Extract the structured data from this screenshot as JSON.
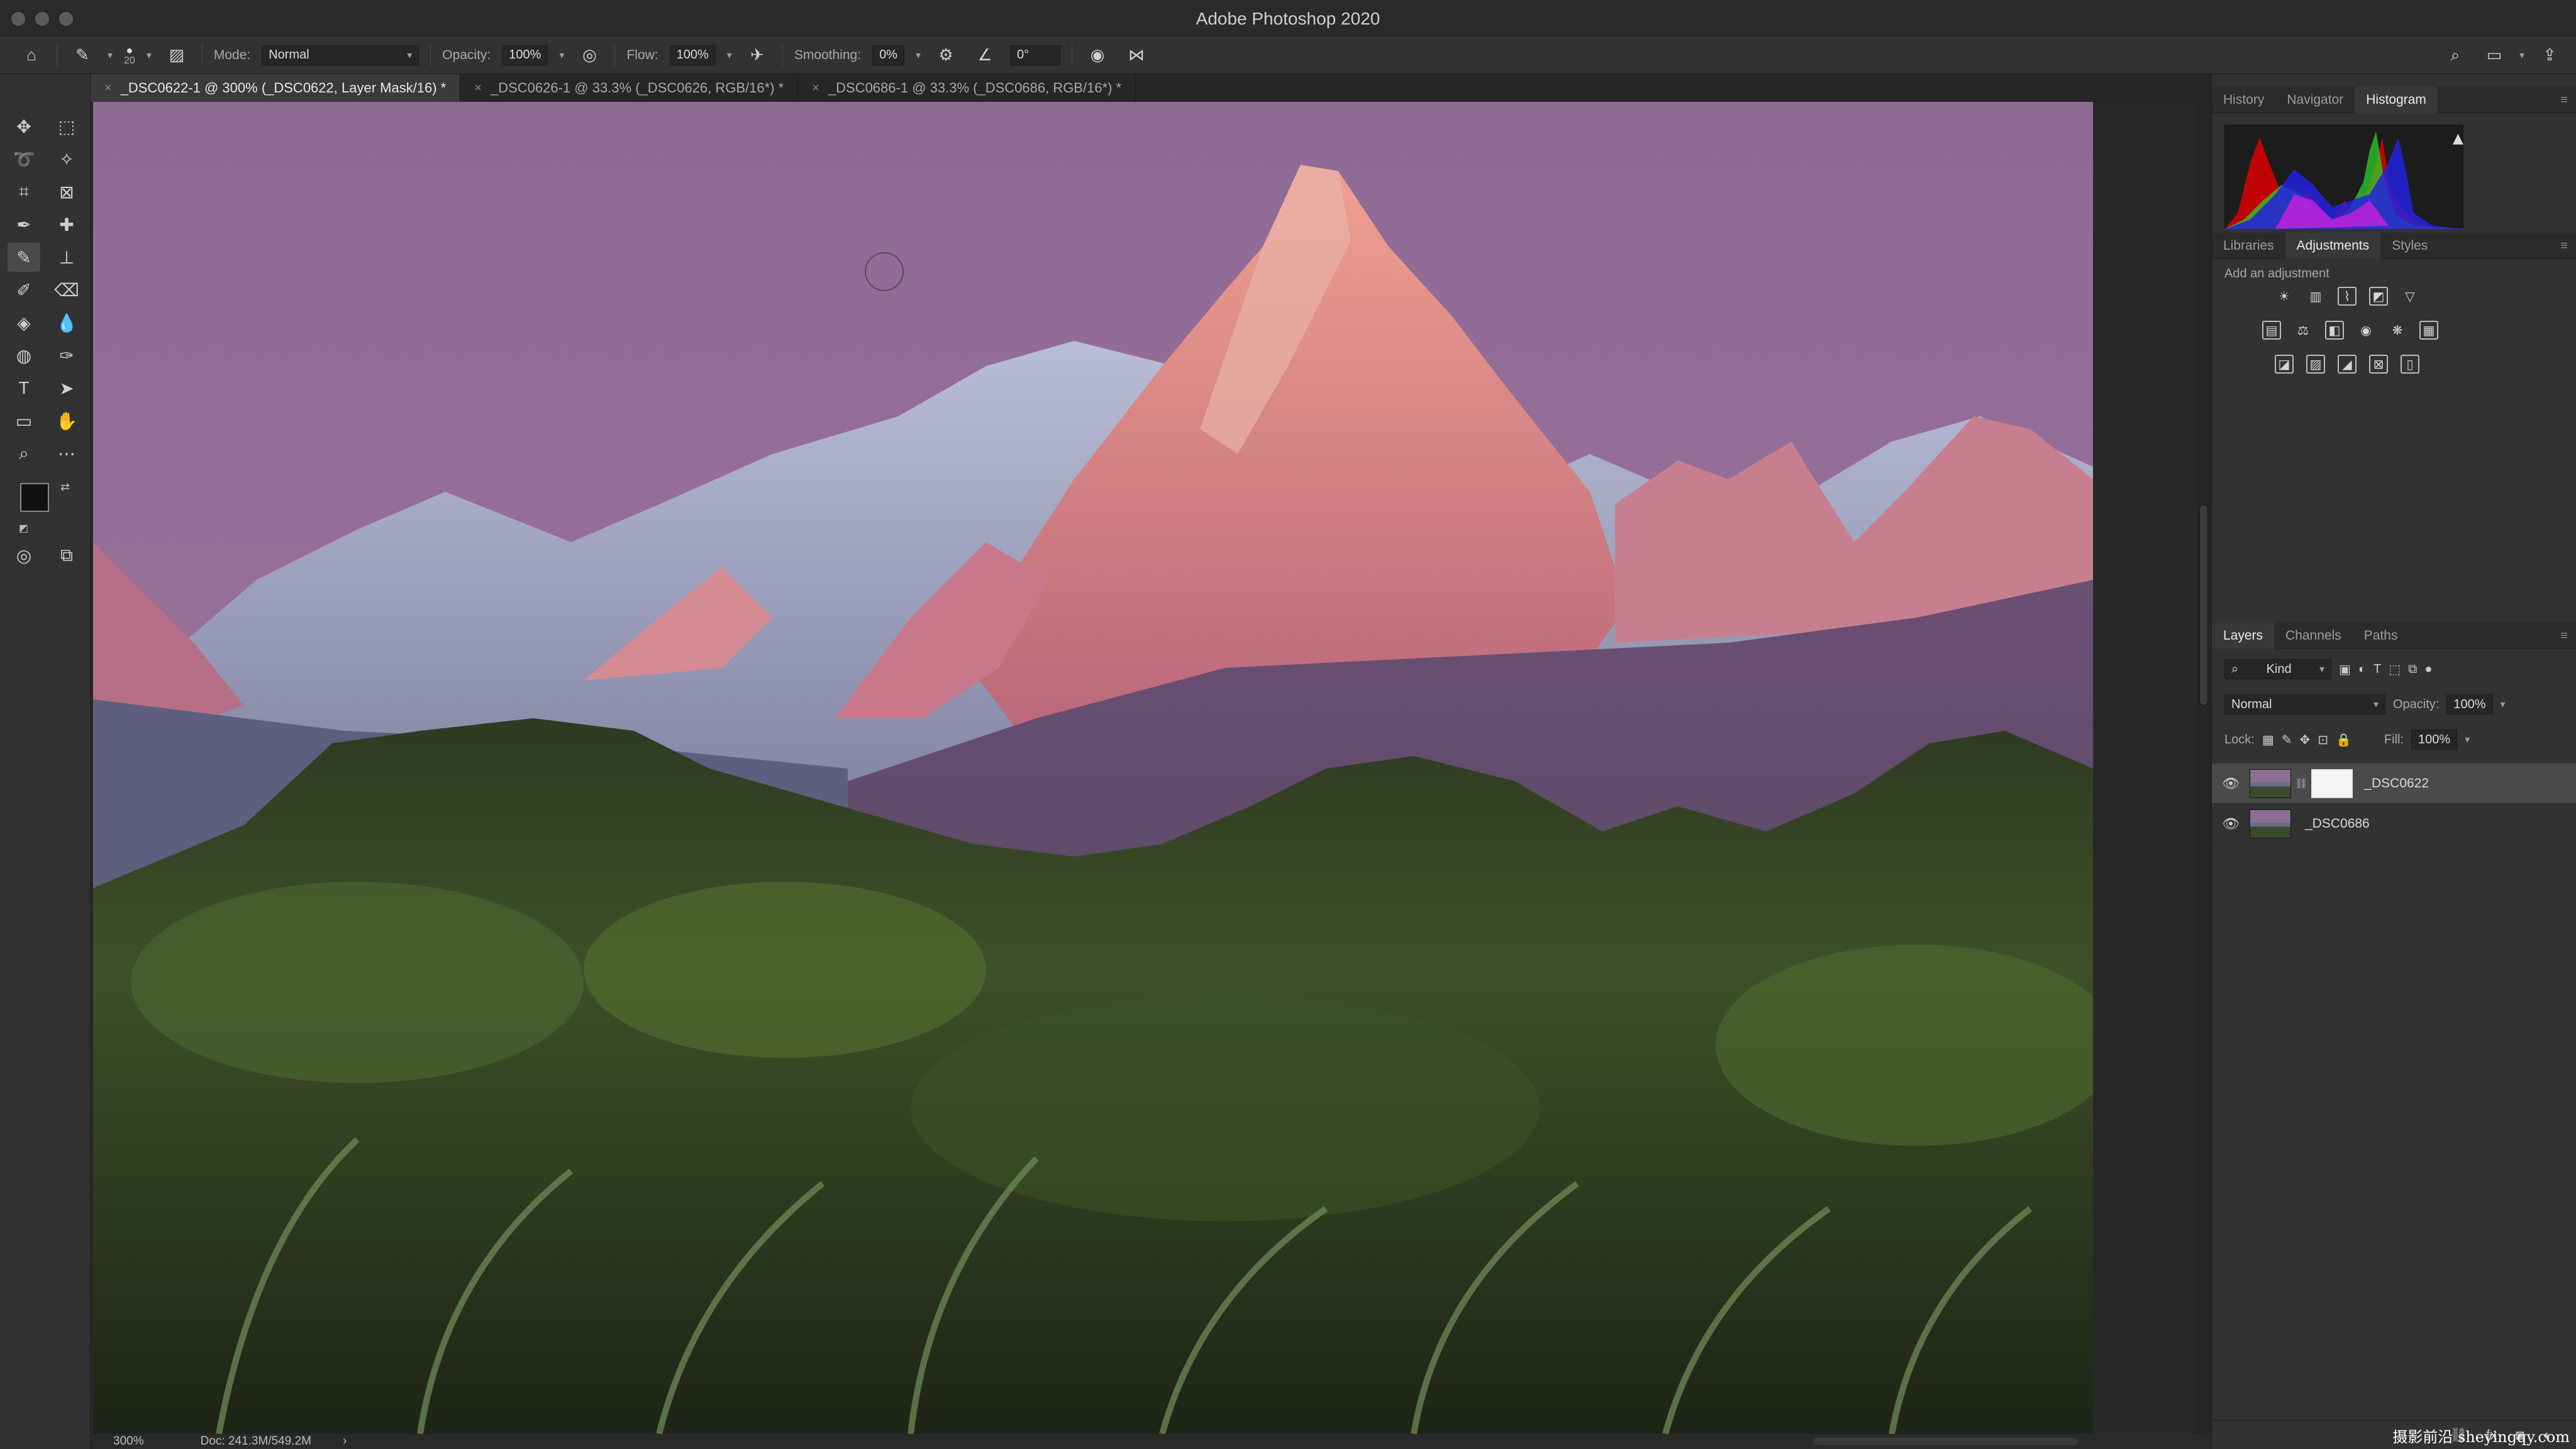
{
  "app": {
    "title": "Adobe Photoshop 2020"
  },
  "options": {
    "brush_size": "20",
    "mode_label": "Mode:",
    "mode_value": "Normal",
    "opacity_label": "Opacity:",
    "opacity_value": "100%",
    "flow_label": "Flow:",
    "flow_value": "100%",
    "smoothing_label": "Smoothing:",
    "smoothing_value": "0%",
    "angle_value": "0°"
  },
  "tabs": [
    {
      "label": "_DSC0622-1 @ 300% (_DSC0622, Layer Mask/16) *"
    },
    {
      "label": "_DSC0626-1 @ 33.3% (_DSC0626, RGB/16*) *"
    },
    {
      "label": "_DSC0686-1 @ 33.3% (_DSC0686, RGB/16*) *"
    }
  ],
  "status": {
    "zoom": "300%",
    "doc": "Doc: 241.3M/549.2M",
    "arrow": "›"
  },
  "panels": {
    "top_tabs": [
      "History",
      "Navigator",
      "Histogram"
    ],
    "mid_tabs": [
      "Libraries",
      "Adjustments",
      "Styles"
    ],
    "add_adjustment": "Add an adjustment",
    "layer_tabs": [
      "Layers",
      "Channels",
      "Paths"
    ],
    "kind_label": "Kind",
    "blend_mode": "Normal",
    "opacity_label": "Opacity:",
    "opacity_value": "100%",
    "lock_label": "Lock:",
    "fill_label": "Fill:",
    "fill_value": "100%",
    "layers": [
      {
        "name": "_DSC0622"
      },
      {
        "name": "_DSC0686"
      }
    ]
  },
  "watermark": "摄影前沿 sheyingqy.com",
  "colors": {
    "accent": "#1f74e0",
    "panel": "#323232",
    "sky": "#8d6f93"
  }
}
